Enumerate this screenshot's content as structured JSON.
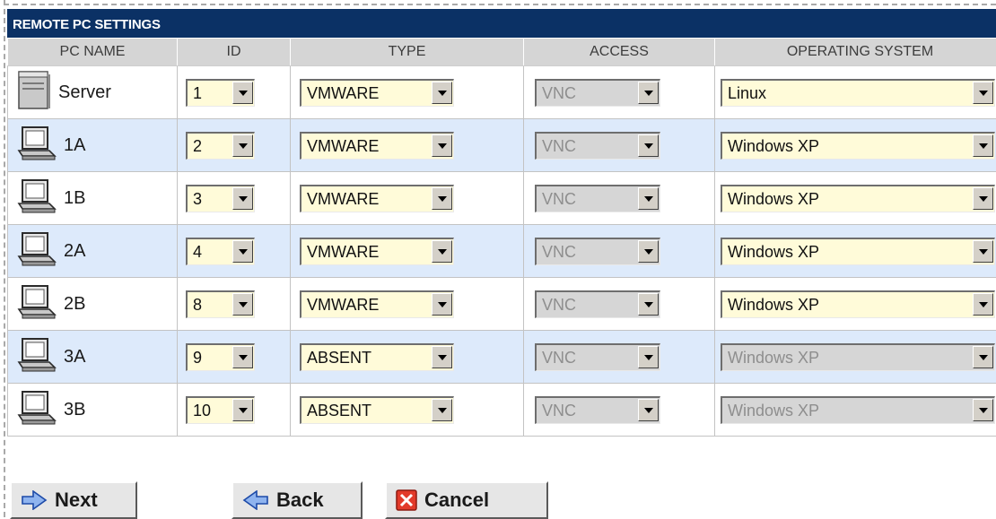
{
  "panel": {
    "title": "REMOTE PC SETTINGS"
  },
  "columns": {
    "pc_name": "PC NAME",
    "id": "ID",
    "type": "TYPE",
    "access": "ACCESS",
    "os": "OPERATING SYSTEM"
  },
  "rows": [
    {
      "name": "Server",
      "icon": "server-icon",
      "id": "1",
      "type": "VMWARE",
      "access": "VNC",
      "access_disabled": true,
      "os": "Linux",
      "os_disabled": false
    },
    {
      "name": "1A",
      "icon": "computer-icon",
      "id": "2",
      "type": "VMWARE",
      "access": "VNC",
      "access_disabled": true,
      "os": "Windows XP",
      "os_disabled": false
    },
    {
      "name": "1B",
      "icon": "computer-icon",
      "id": "3",
      "type": "VMWARE",
      "access": "VNC",
      "access_disabled": true,
      "os": "Windows XP",
      "os_disabled": false
    },
    {
      "name": "2A",
      "icon": "computer-icon",
      "id": "4",
      "type": "VMWARE",
      "access": "VNC",
      "access_disabled": true,
      "os": "Windows XP",
      "os_disabled": false
    },
    {
      "name": "2B",
      "icon": "computer-icon",
      "id": "8",
      "type": "VMWARE",
      "access": "VNC",
      "access_disabled": true,
      "os": "Windows XP",
      "os_disabled": false
    },
    {
      "name": "3A",
      "icon": "computer-icon",
      "id": "9",
      "type": "ABSENT",
      "access": "VNC",
      "access_disabled": true,
      "os": "Windows XP",
      "os_disabled": true
    },
    {
      "name": "3B",
      "icon": "computer-icon",
      "id": "10",
      "type": "ABSENT",
      "access": "VNC",
      "access_disabled": true,
      "os": "Windows XP",
      "os_disabled": true
    }
  ],
  "buttons": {
    "next": "Next",
    "back": "Back",
    "cancel": "Cancel"
  },
  "colors": {
    "title_bar": "#0b3165",
    "row_alt": "#ddeafb",
    "select_bg": "#fffbd9",
    "disabled_bg": "#d6d6d6"
  }
}
